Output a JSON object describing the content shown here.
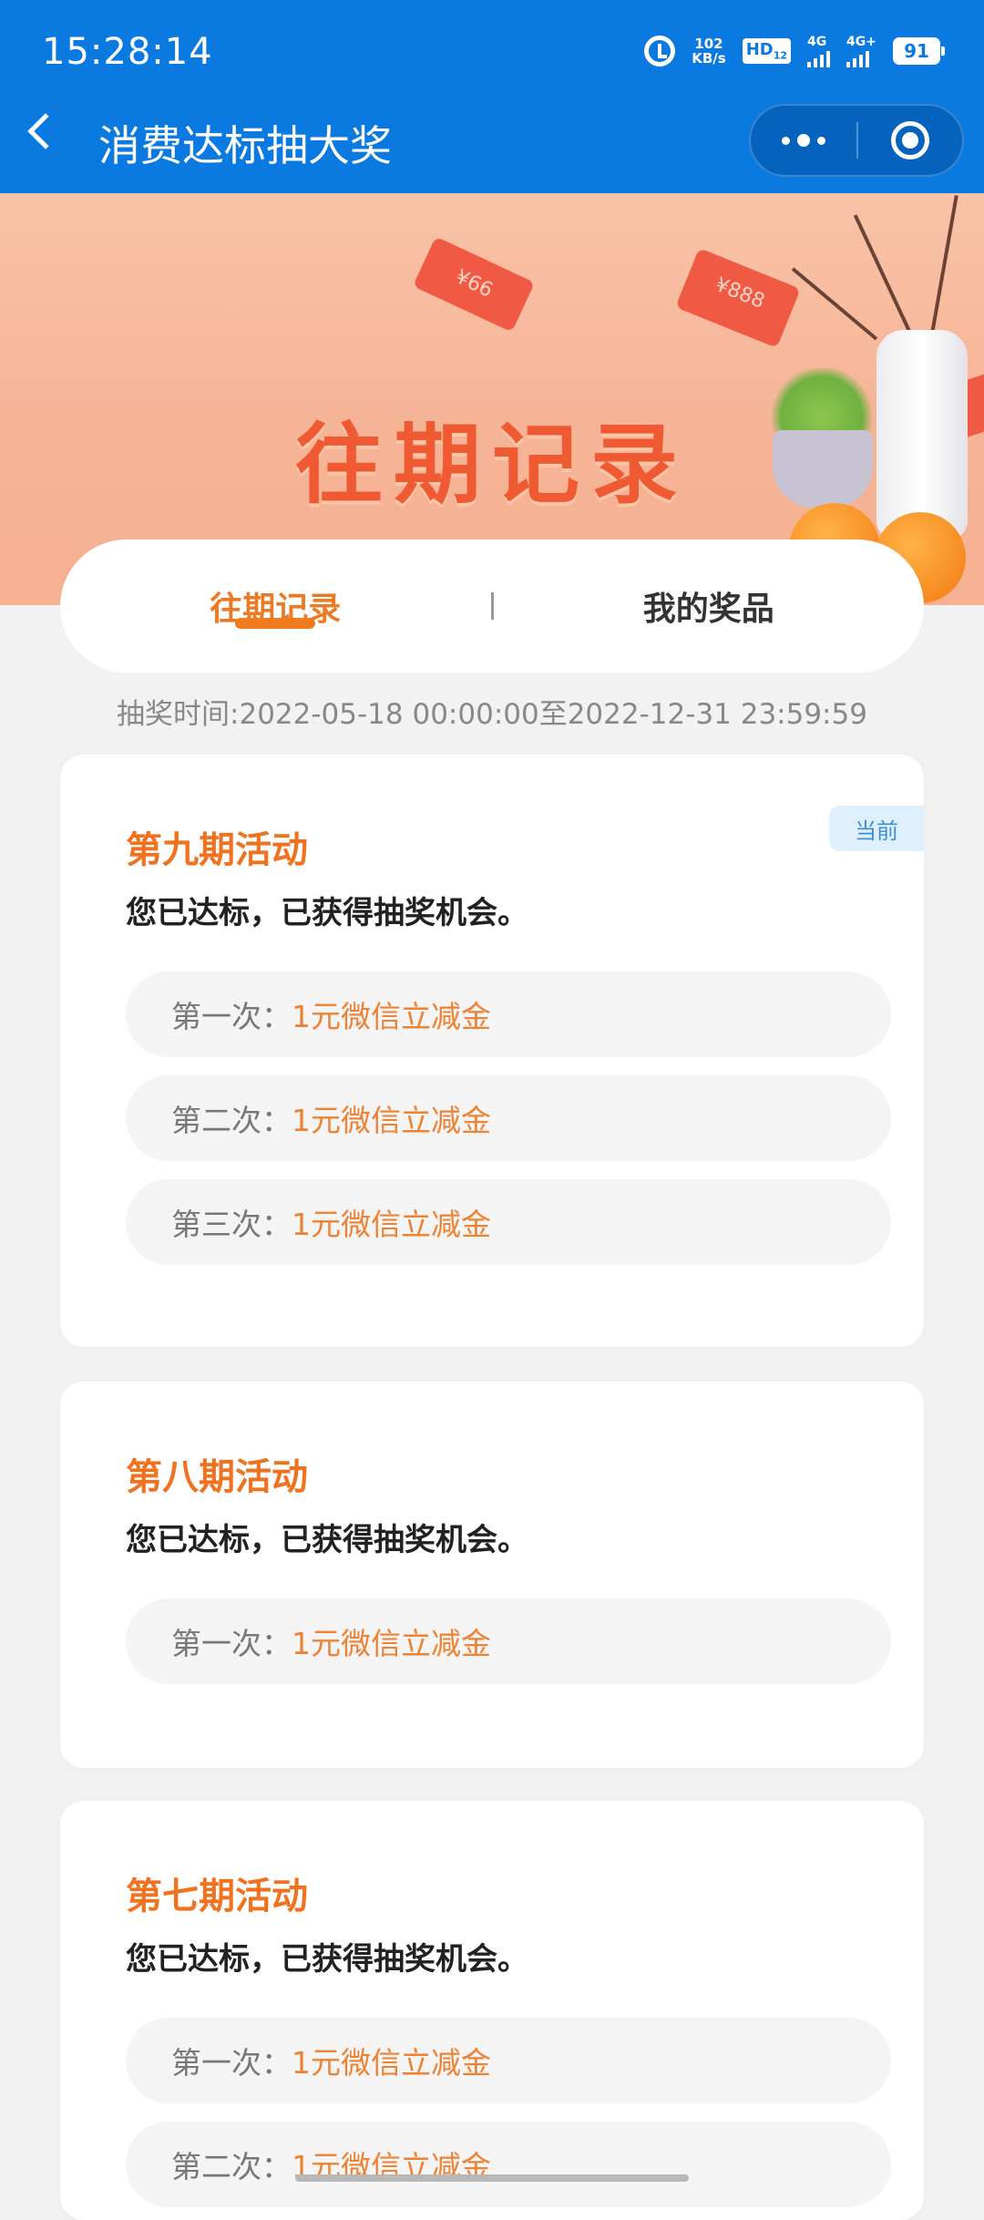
{
  "status_bar": {
    "time": "15:28:14",
    "speed_value": "102",
    "speed_unit": "KB/s",
    "hd_label": "HD",
    "hd_sub": "12",
    "sim1": "4G",
    "sim2": "4G+",
    "battery": "91"
  },
  "nav": {
    "title": "消费达标抽大奖"
  },
  "banner": {
    "title": "往期记录",
    "envelope1": "¥66",
    "envelope2": "¥888"
  },
  "tabs": [
    {
      "label": "往期记录",
      "active": true
    },
    {
      "label": "我的奖品",
      "active": false
    }
  ],
  "draw_time": "抽奖时间:2022-05-18 00:00:00至2022-12-31 23:59:59",
  "cards": [
    {
      "title": "第九期活动",
      "subtitle": "您已达标，已获得抽奖机会。",
      "badge": "当前",
      "prizes": [
        {
          "label": "第一次：",
          "value": "1元微信立减金"
        },
        {
          "label": "第二次：",
          "value": "1元微信立减金"
        },
        {
          "label": "第三次：",
          "value": "1元微信立减金"
        }
      ]
    },
    {
      "title": "第八期活动",
      "subtitle": "您已达标，已获得抽奖机会。",
      "prizes": [
        {
          "label": "第一次：",
          "value": "1元微信立减金"
        }
      ]
    },
    {
      "title": "第七期活动",
      "subtitle": "您已达标，已获得抽奖机会。",
      "prizes": [
        {
          "label": "第一次：",
          "value": "1元微信立减金"
        },
        {
          "label": "第二次：",
          "value": "1元微信立减金"
        }
      ]
    }
  ],
  "colors": {
    "nav_blue": "#0a7ae0",
    "accent_orange": "#f0721f",
    "prize_orange": "#ee8233",
    "banner_title": "#ef5a32"
  }
}
